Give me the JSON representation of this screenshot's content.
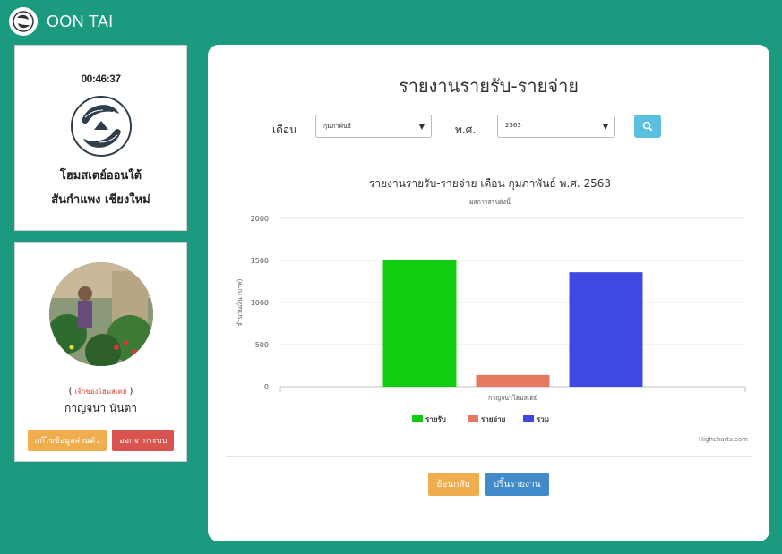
{
  "app": {
    "title": "OON TAI"
  },
  "clock": {
    "time": "00:46:37"
  },
  "home": {
    "name": "โฮมสเตย์ออนใต้",
    "location": "สันกำแพง เชียงใหม่"
  },
  "user": {
    "role_open": "(",
    "role": "เจ้าของโฮมสเตย์",
    "role_close": ")",
    "name": "กาญจนา นันตา",
    "edit_label": "แก้ไขข้อมูลส่วนตัว",
    "logout_label": "ออกจากระบบ"
  },
  "report": {
    "title": "รายงานรายรับ-รายจ่าย",
    "month_label": "เดือน",
    "month_value": "กุมภาพันธ์",
    "year_label": "พ.ศ.",
    "year_value": "2563",
    "back_label": "ย้อนกลับ",
    "print_label": "ปริ้นรายงาน"
  },
  "chart_data": {
    "type": "bar",
    "title": "รายงานรายรับ-รายจ่าย เดือน กุมภาพันธ์ พ.ศ. 2563",
    "subtitle": "ผลการสรุปดังนี้",
    "xlabel": "กาญจนาโฮมสเตย์",
    "ylabel": "จำนวนเงิน (บาท)",
    "ylim": [
      0,
      2000
    ],
    "yticks": [
      0,
      500,
      1000,
      1500,
      2000
    ],
    "categories": [
      "กาญจนาโฮมสเตย์"
    ],
    "series": [
      {
        "name": "รายรับ",
        "values": [
          1500
        ],
        "color": "#12cc12"
      },
      {
        "name": "รายจ่าย",
        "values": [
          140
        ],
        "color": "#e57a61"
      },
      {
        "name": "รวม",
        "values": [
          1360
        ],
        "color": "#3f48e0"
      }
    ],
    "legend": "bottom-center",
    "credits": "Highcharts.com",
    "grid": true
  }
}
